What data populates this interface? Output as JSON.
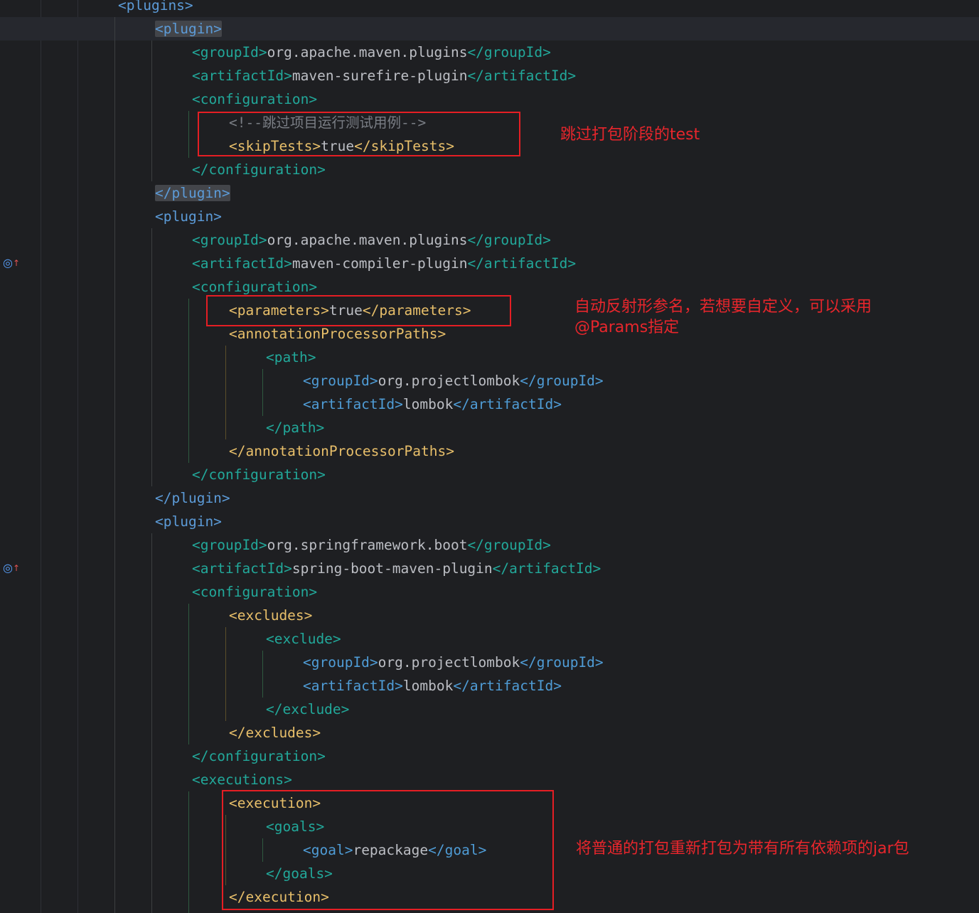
{
  "editor": {
    "colors": {
      "background": "#1e1f22",
      "tag": "#e8bf6a",
      "tag_group_id": "#4f9cd6",
      "tag_generic": "#5c9bd8",
      "tag_muted": "#22a89a",
      "text": "#bcbec4",
      "comment": "#7a7e85",
      "annotation_red": "#e8262c"
    },
    "lines": [
      {
        "open": "plugins",
        "color": "tag_generic"
      },
      {
        "open": "plugin",
        "color": "tag_generic",
        "highlight": true
      },
      {
        "open": "groupId",
        "text": "org.apache.maven.plugins",
        "close": "groupId",
        "color": "tag_muted"
      },
      {
        "open": "artifactId",
        "text": "maven-surefire-plugin",
        "close": "artifactId",
        "color": "tag_muted"
      },
      {
        "open": "configuration",
        "color": "tag_muted"
      },
      {
        "comment": "<!--跳过项目运行测试用例-->"
      },
      {
        "open": "skipTests",
        "text": "true",
        "close": "skipTests",
        "color": "tag"
      },
      {
        "close": "configuration",
        "color": "tag_muted"
      },
      {
        "close": "plugin",
        "color": "tag_generic",
        "highlight": true
      },
      {
        "open": "plugin",
        "color": "tag_generic"
      },
      {
        "open": "groupId",
        "text": "org.apache.maven.plugins",
        "close": "groupId",
        "color": "tag_muted"
      },
      {
        "open": "artifactId",
        "text": "maven-compiler-plugin",
        "close": "artifactId",
        "color": "tag_muted",
        "gutter_icon": "target-icon"
      },
      {
        "open": "configuration",
        "color": "tag_muted"
      },
      {
        "open": "parameters",
        "text": "true",
        "close": "parameters",
        "color": "tag"
      },
      {
        "open": "annotationProcessorPaths",
        "color": "tag"
      },
      {
        "open": "path",
        "color": "tag_muted"
      },
      {
        "open": "groupId",
        "text": "org.projectlombok",
        "close": "groupId",
        "color": "tag_group_id"
      },
      {
        "open": "artifactId",
        "text": "lombok",
        "close": "artifactId",
        "color": "tag_group_id"
      },
      {
        "close": "path",
        "color": "tag_muted"
      },
      {
        "close": "annotationProcessorPaths",
        "color": "tag"
      },
      {
        "close": "configuration",
        "color": "tag_muted"
      },
      {
        "close": "plugin",
        "color": "tag_generic"
      },
      {
        "open": "plugin",
        "color": "tag_generic"
      },
      {
        "open": "groupId",
        "text": "org.springframework.boot",
        "close": "groupId",
        "color": "tag_muted"
      },
      {
        "open": "artifactId",
        "text": "spring-boot-maven-plugin",
        "close": "artifactId",
        "color": "tag_muted",
        "gutter_icon": "target-icon"
      },
      {
        "open": "configuration",
        "color": "tag_muted"
      },
      {
        "open": "excludes",
        "color": "tag"
      },
      {
        "open": "exclude",
        "color": "tag_muted"
      },
      {
        "open": "groupId",
        "text": "org.projectlombok",
        "close": "groupId",
        "color": "tag_group_id"
      },
      {
        "open": "artifactId",
        "text": "lombok",
        "close": "artifactId",
        "color": "tag_group_id"
      },
      {
        "close": "exclude",
        "color": "tag_muted"
      },
      {
        "close": "excludes",
        "color": "tag"
      },
      {
        "close": "configuration",
        "color": "tag_muted"
      },
      {
        "open": "executions",
        "color": "tag_muted"
      },
      {
        "open": "execution",
        "color": "tag"
      },
      {
        "open": "goals",
        "color": "tag_muted"
      },
      {
        "open": "goal",
        "text": "repackage",
        "close": "goal",
        "color": "tag_group_id"
      },
      {
        "close": "goals",
        "color": "tag_muted"
      },
      {
        "close": "execution",
        "color": "tag"
      }
    ]
  },
  "annotations": [
    {
      "label": "跳过打包阶段的test"
    },
    {
      "label": "自动反射形参名，若想要自定义，可以采用\n@Params指定"
    },
    {
      "label": "将普通的打包重新打包为带有所有依赖项的jar包"
    }
  ]
}
